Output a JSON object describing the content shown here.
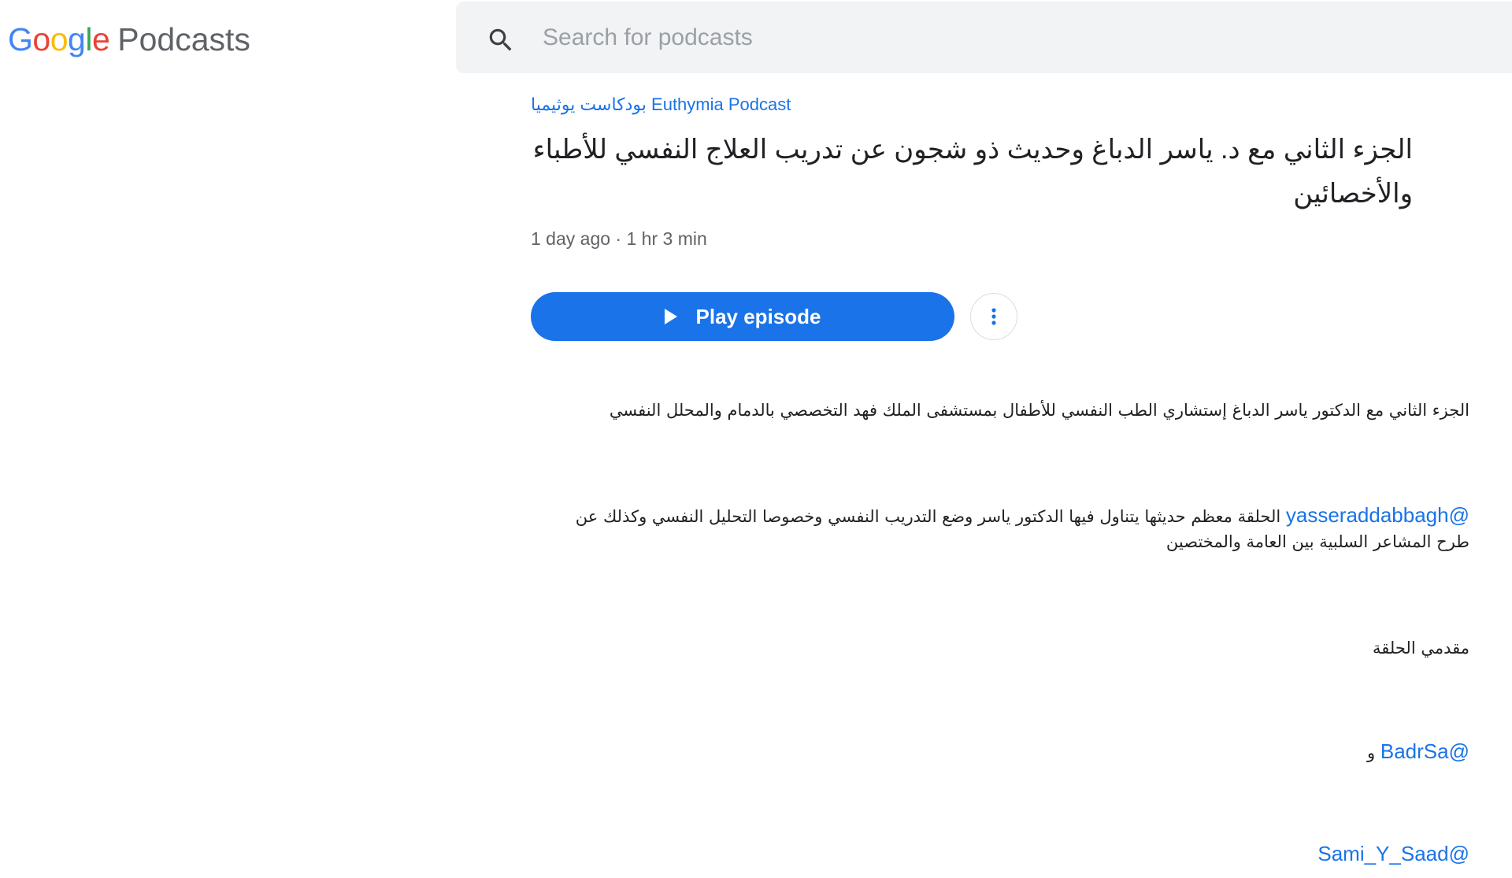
{
  "header": {
    "logo_google_letters": [
      "G",
      "o",
      "o",
      "g",
      "l",
      "e"
    ],
    "logo_google_colors": [
      "#4285F4",
      "#EA4335",
      "#FBBC05",
      "#4285F4",
      "#34A853",
      "#EA4335"
    ],
    "logo_product": "Podcasts",
    "search": {
      "placeholder": "Search for podcasts",
      "value": "",
      "icon": "search-icon"
    }
  },
  "episode": {
    "podcast_name": "بودكاست يوثيميا Euthymia Podcast",
    "title": "الجزء الثاني مع د. ياسر الدباغ وحديث ذو شجون عن تدريب العلاج النفسي للأطباء والأخصائين",
    "published": "1 day ago",
    "separator": "·",
    "duration": "1 hr 3 min",
    "play_label": "Play episode",
    "play_icon": "play-icon",
    "more_icon": "more-vert-icon",
    "accent_color": "#1a73e8"
  },
  "description": {
    "paragraph1": "الجزء الثاني مع الدكتور ياسر الدباغ إستشاري الطب النفسي للأطفال بمستشفى الملك فهد التخصصي بالدمام والمحلل النفسي",
    "paragraph2_mention": "@yasseraddabbagh",
    "paragraph2_line1": " الحلقة معظم حديثها يتناول فيها الدكتور ياسر وضع التدريب النفسي وخصوصا التحليل النفسي وكذلك عن",
    "paragraph2_line2": "طرح المشاعر السلبية بين العامة والمختصين",
    "hosts_label": "مقدمي الحلقة",
    "host1_mention": "@BadrSa",
    "host_and": " و",
    "host2_mention": "@Sami_Y_Saad"
  }
}
